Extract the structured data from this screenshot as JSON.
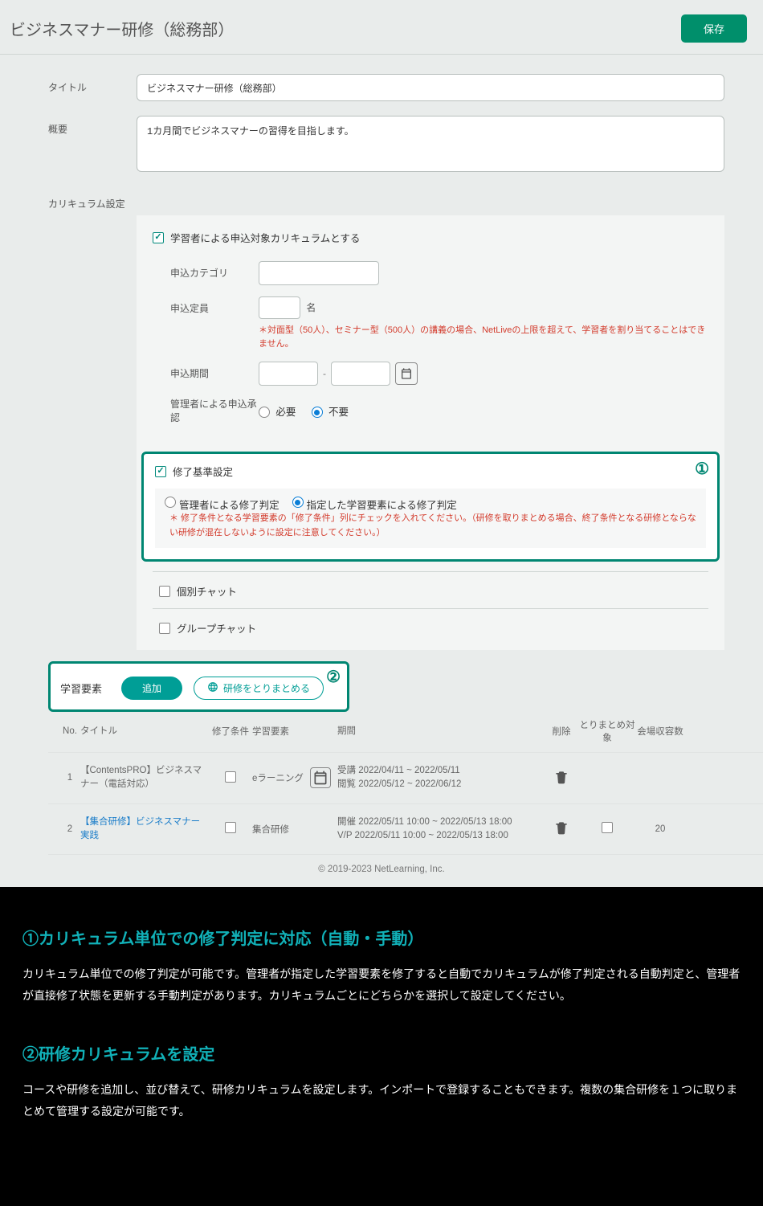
{
  "header": {
    "title": "ビジネスマナー研修（総務部）",
    "save": "保存"
  },
  "form": {
    "title_label": "タイトル",
    "title_value": "ビジネスマナー研修（総務部）",
    "overview_label": "概要",
    "overview_value": "1カ月間でビジネスマナーの習得を目指します。",
    "curr_label": "カリキュラム設定"
  },
  "curr": {
    "learner_apply": "学習者による申込対象カリキュラムとする",
    "category_label": "申込カテゴリ",
    "capacity_label": "申込定員",
    "capacity_unit": "名",
    "capacity_warn": "＊対面型（50人）、セミナー型（500人）の講義の場合、NetLiveの上限を超えて、学習者を割り当てることはできません。",
    "period_label": "申込期間",
    "period_sep": "-",
    "approval_label": "管理者による申込承認",
    "approval_need": "必要",
    "approval_noneed": "不要"
  },
  "comp": {
    "callout": "①",
    "title": "修了基準設定",
    "by_admin": "管理者による修了判定",
    "by_elem": "指定した学習要素による修了判定",
    "warn": "＊ 修了条件となる学習要素の「修了条件」列にチェックを入れてください。（研修を取りまとめる場合、終了条件となる研修とならない研修が混在しないように設定に注意してください。）"
  },
  "chat": {
    "individual": "個別チャット",
    "group": "グループチャット"
  },
  "elements": {
    "callout": "②",
    "title": "学習要素",
    "add": "追加",
    "wrap": "研修をとりまとめる",
    "cols": {
      "no": "No.",
      "title": "タイトル",
      "cond": "修了条件",
      "type": "学習要素",
      "period": "期間",
      "del": "削除",
      "target": "とりまとめ対象",
      "cap": "会場収容数"
    },
    "rows": [
      {
        "no": "1",
        "title": "【ContentsPRO】ビジネスマナー（電話対応）",
        "type": "eラーニング",
        "period_l1": "受講  2022/04/11 ~ 2022/05/11",
        "period_l2": "閲覧  2022/05/12 ~ 2022/06/12",
        "link": false,
        "show_cal": true,
        "show_target": false,
        "cap": ""
      },
      {
        "no": "2",
        "title": "【集合研修】ビジネスマナー実践",
        "type": "集合研修",
        "period_l1": "開催  2022/05/11 10:00 ~ 2022/05/13 18:00",
        "period_l2": "V/P  2022/05/11 10:00 ~ 2022/05/13 18:00",
        "link": true,
        "show_cal": false,
        "show_target": true,
        "cap": "20"
      }
    ]
  },
  "footer": "© 2019-2023 NetLearning, Inc.",
  "explain": {
    "h1": "①カリキュラム単位での修了判定に対応（自動・手動）",
    "p1": "カリキュラム単位での修了判定が可能です。管理者が指定した学習要素を修了すると自動でカリキュラムが修了判定される自動判定と、管理者が直接修了状態を更新する手動判定があります。カリキュラムごとにどちらかを選択して設定してください。",
    "h2": "②研修カリキュラムを設定",
    "p2": "コースや研修を追加し、並び替えて、研修カリキュラムを設定します。インポートで登録することもできます。複数の集合研修を１つに取りまとめて管理する設定が可能です。"
  }
}
